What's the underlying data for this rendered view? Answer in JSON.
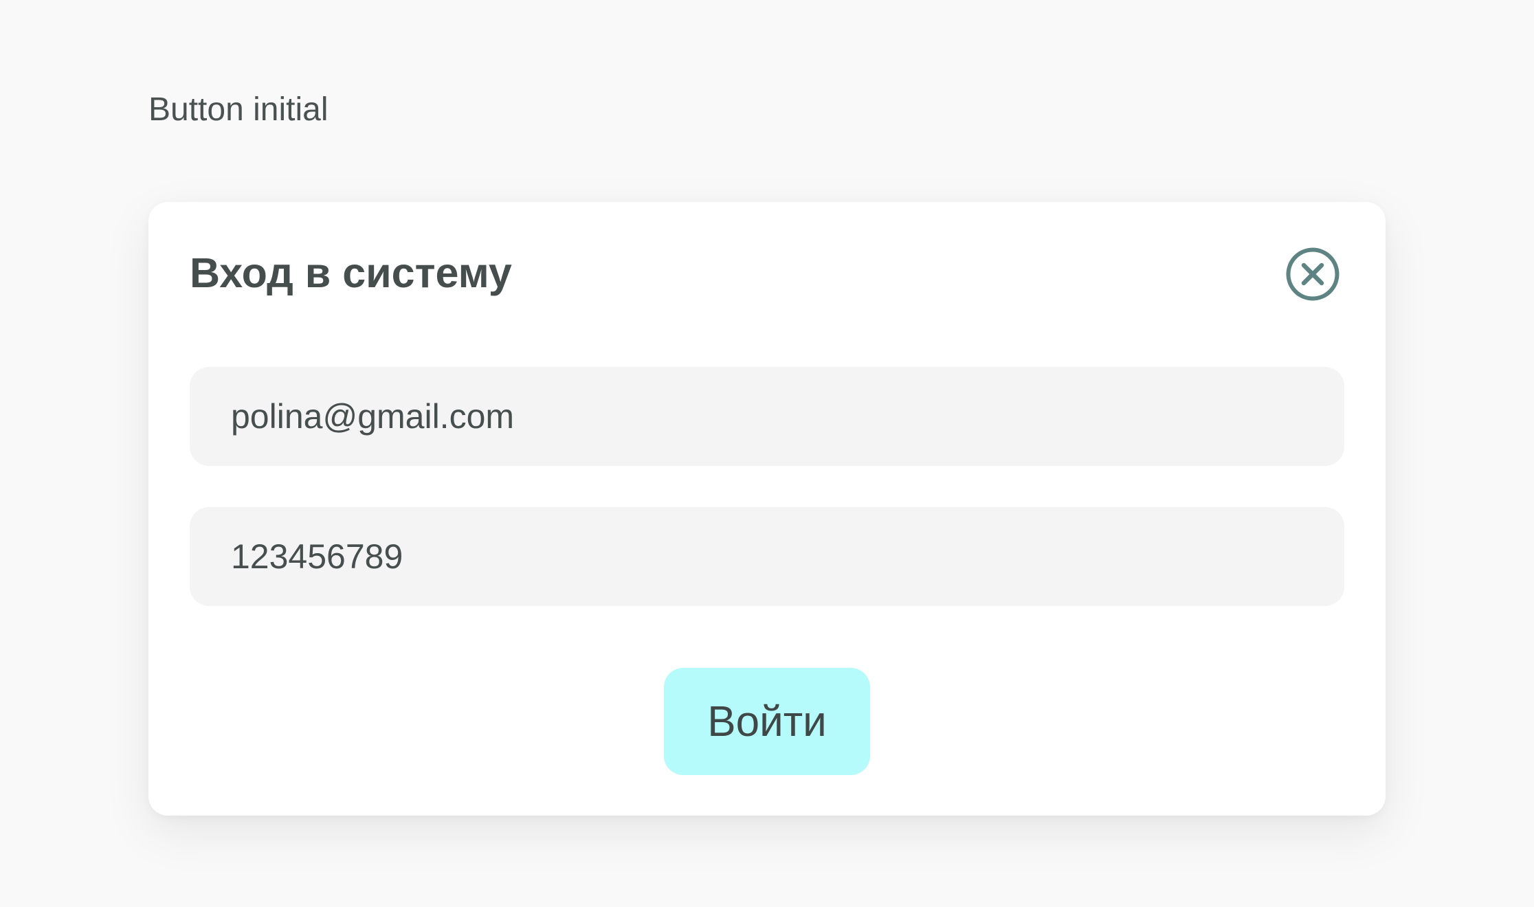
{
  "page": {
    "state_label": "Button initial"
  },
  "modal": {
    "title": "Вход в систему",
    "close_icon": "close-circle-icon",
    "email_value": "polina@gmail.com",
    "password_value": "123456789",
    "submit_label": "Войти"
  },
  "colors": {
    "background": "#f9f9f9",
    "card": "#ffffff",
    "input_background": "#f4f4f4",
    "button_background": "#b5fbfb",
    "close_icon": "#5e8383",
    "text": "#454d4d"
  }
}
